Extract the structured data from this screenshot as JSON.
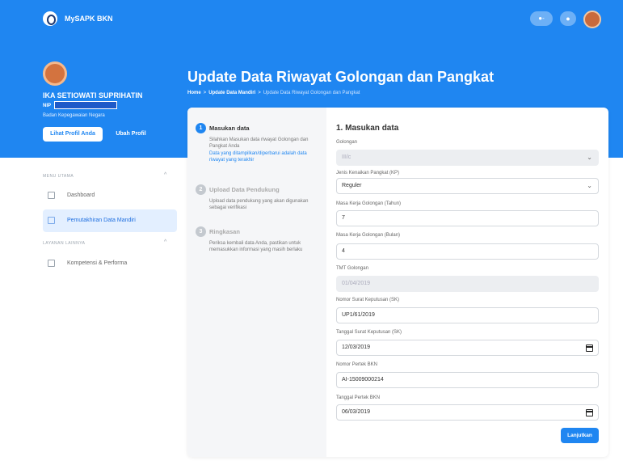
{
  "header": {
    "app_title": "MySAPK BKN",
    "pill_icon": "●-",
    "bell_icon": "●"
  },
  "profile": {
    "name": "IKA SETIOWATI SUPRIHATIN",
    "nip_label": "NIP",
    "org": "Badan Kepegawaian Negara",
    "view_profile": "Lihat Profil Anda",
    "edit_profile": "Ubah Profil"
  },
  "page": {
    "title": "Update Data Riwayat Golongan dan Pangkat",
    "breadcrumb": [
      "Home",
      "Update Data Mandiri",
      "Update Data Riwayat Golongan dan Pangkat"
    ],
    "breadcrumb_sep": ">"
  },
  "sidebar": {
    "section1": "MENU UTAMA",
    "section2": "LAYANAN LAINNYA",
    "caret": "^",
    "items": [
      {
        "label": "Dashboard"
      },
      {
        "label": "Pemutakhiran Data Mandiri"
      },
      {
        "label": "Kompetensi & Performa"
      }
    ]
  },
  "steps": [
    {
      "num": "1",
      "title": "Masukan data",
      "desc": "Silahkan Masukan data riwayat Golongan dan Pangkat Anda",
      "link": "Data yang ditampilkan/diperbarui adalah data riwayat yang terakhir"
    },
    {
      "num": "2",
      "title": "Upload Data Pendukung",
      "desc": "Upload data pendukung yang akan digunakan sebagai verifikasi"
    },
    {
      "num": "3",
      "title": "Ringkasan",
      "desc": "Periksa kembali data Anda, pastikan untuk memasukkan informasi yang masih berlaku"
    }
  ],
  "form": {
    "title": "1. Masukan data",
    "golongan": {
      "label": "Golongan",
      "value": "III/c"
    },
    "jenis_kp": {
      "label": "Jenis Kenaikan Pangkat (KP)",
      "value": "Reguler"
    },
    "mk_tahun": {
      "label": "Masa Kerja Golongan (Tahun)",
      "value": "7"
    },
    "mk_bulan": {
      "label": "Masa Kerja Golongan (Bulan)",
      "value": "4"
    },
    "tmt": {
      "label": "TMT Golongan",
      "value": "01/04/2019"
    },
    "nomor_sk": {
      "label": "Nomor Surat Keputusan (SK)",
      "value": "UP1/61/2019"
    },
    "tanggal_sk": {
      "label": "Tanggal Surat Keputusan (SK)",
      "value": "12/03/2019"
    },
    "nomor_pertek": {
      "label": "Nomor Pertek BKN",
      "value": "AI-15009000214"
    },
    "tanggal_pertek": {
      "label": "Tanggal Pertek BKN",
      "value": "06/03/2019"
    },
    "next_button": "Lanjutkan",
    "chevron": "⌄"
  },
  "colors": {
    "primary": "#1f86f1",
    "active_bg": "#e3efff"
  }
}
